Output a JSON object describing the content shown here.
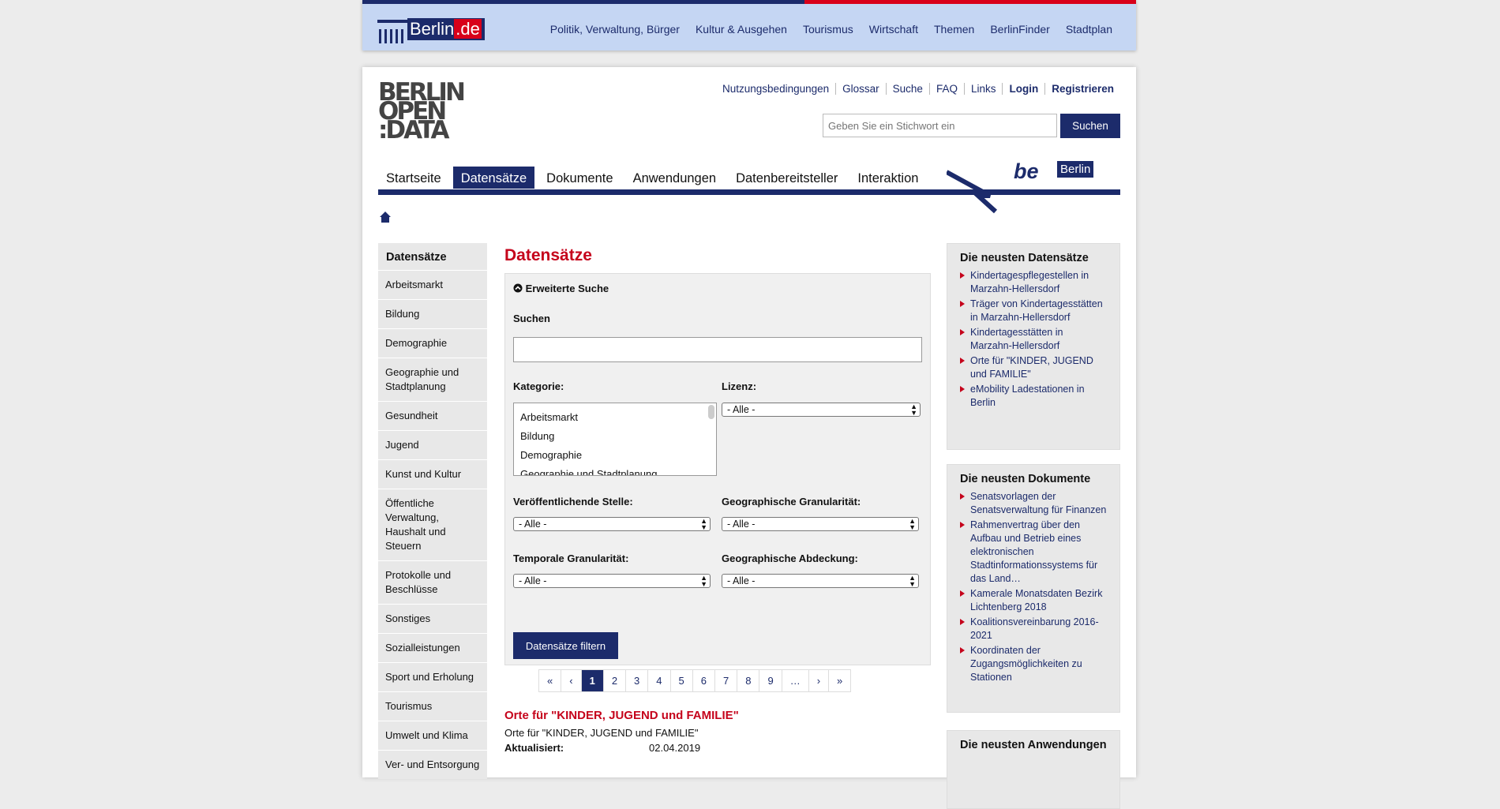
{
  "topbar": {
    "logo_text": "Berlin",
    "logo_tld": ".de",
    "nav": [
      "Politik, Verwaltung, Bürger",
      "Kultur & Ausgehen",
      "Tourismus",
      "Wirtschaft",
      "Themen",
      "BerlinFinder",
      "Stadtplan"
    ]
  },
  "header": {
    "logo": "BERLIN OPEN DATA",
    "util": [
      "Nutzungsbedingungen",
      "Glossar",
      "Suche",
      "FAQ",
      "Links",
      "Login",
      "Registrieren"
    ],
    "search_placeholder": "Geben Sie ein Stichwort ein",
    "search_button": "Suchen",
    "main_nav": [
      "Startseite",
      "Datensätze",
      "Dokumente",
      "Anwendungen",
      "Datenbereitsteller",
      "Interaktion"
    ],
    "be_logo": "be",
    "be_berlin": "Berlin"
  },
  "sidebar": {
    "title": "Datensätze",
    "items": [
      "Arbeitsmarkt",
      "Bildung",
      "Demographie",
      "Geographie und Stadtplanung",
      "Gesundheit",
      "Jugend",
      "Kunst und Kultur",
      "Öffentliche Verwaltung, Haushalt und Steuern",
      "Protokolle und Beschlüsse",
      "Sonstiges",
      "Sozialleistungen",
      "Sport und Erholung",
      "Tourismus",
      "Umwelt und Klima",
      "Ver- und Entsorgung"
    ]
  },
  "main": {
    "title": "Datensätze",
    "adv_label": "Erweiterte Suche",
    "search_label": "Suchen",
    "kategorie_label": "Kategorie:",
    "kategorie_options": [
      "Arbeitsmarkt",
      "Bildung",
      "Demographie",
      "Geographie und Stadtplanung"
    ],
    "lizenz_label": "Lizenz:",
    "lizenz_value": "- Alle -",
    "stelle_label": "Veröffentlichende Stelle:",
    "stelle_value": "- Alle -",
    "geo_gran_label": "Geographische Granularität:",
    "geo_gran_value": "- Alle -",
    "temp_gran_label": "Temporale Granularität:",
    "temp_gran_value": "- Alle -",
    "geo_abd_label": "Geographische Abdeckung:",
    "geo_abd_value": "- Alle -",
    "filter_button": "Datensätze filtern",
    "pager": [
      "«",
      "‹",
      "1",
      "2",
      "3",
      "4",
      "5",
      "6",
      "7",
      "8",
      "9",
      "…",
      "›",
      "»"
    ],
    "pager_current": "1",
    "result_title": "Orte für \"KINDER, JUGEND und FAMILIE\"",
    "result_desc": "Orte für \"KINDER, JUGEND und FAMILIE\"",
    "result_meta_label": "Aktualisiert:",
    "result_meta_value": "02.04.2019"
  },
  "right": {
    "datasets_title": "Die neusten Datensätze",
    "datasets": [
      "Kindertagespflegestellen in Marzahn-Hellersdorf",
      "Träger von Kindertagesstätten in Marzahn-Hellersdorf",
      "Kindertagesstätten in Marzahn-Hellersdorf",
      "Orte für \"KINDER, JUGEND und FAMILIE\"",
      "eMobility Ladestationen in Berlin"
    ],
    "docs_title": "Die neusten Dokumente",
    "docs": [
      "Senatsvorlagen der Senatsverwaltung für Finanzen",
      "Rahmenvertrag über den Aufbau und Betrieb eines elektronischen Stadtinformationssystems für das Land…",
      "Kamerale Monatsdaten Bezirk Lichtenberg 2018",
      "Koalitionsvereinbarung 2016-2021",
      "Koordinaten der Zugangsmöglichkeiten zu Stationen"
    ],
    "apps_title": "Die neusten Anwendungen"
  }
}
